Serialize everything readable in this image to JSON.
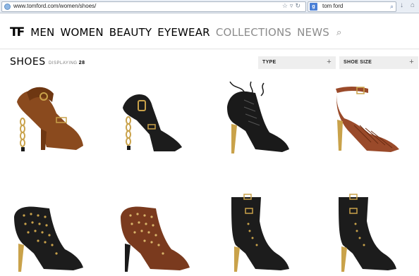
{
  "browser": {
    "url": "www.tomford.com/women/shoes/",
    "search_engine_icon": "google-icon",
    "search_text": "tom ford"
  },
  "site": {
    "logo": "TF",
    "nav": [
      "MEN",
      "WOMEN",
      "BEAUTY",
      "EYEWEAR",
      "COLLECTIONS",
      "NEWS"
    ]
  },
  "listing": {
    "title": "SHOES",
    "displaying_label": "DISPLAYING",
    "displaying_count": "28",
    "filters": [
      "TYPE",
      "SHOE SIZE"
    ]
  },
  "products": [
    {
      "name": "brown leather padlock sandal",
      "color": "#8a4a1e"
    },
    {
      "name": "black leather padlock sandal",
      "color": "#1c1c1c"
    },
    {
      "name": "black lace-up studded bootie",
      "color": "#1a1a1a"
    },
    {
      "name": "tan woven ankle-strap sandal",
      "color": "#9a4a2a"
    },
    {
      "name": "black grommet bootie",
      "color": "#1c1c1c"
    },
    {
      "name": "brown grommet bootie",
      "color": "#7a3a1e"
    },
    {
      "name": "black buckle lace-up boot",
      "color": "#1c1c1c"
    },
    {
      "name": "black buckle lace-up boot",
      "color": "#1c1c1c"
    }
  ]
}
